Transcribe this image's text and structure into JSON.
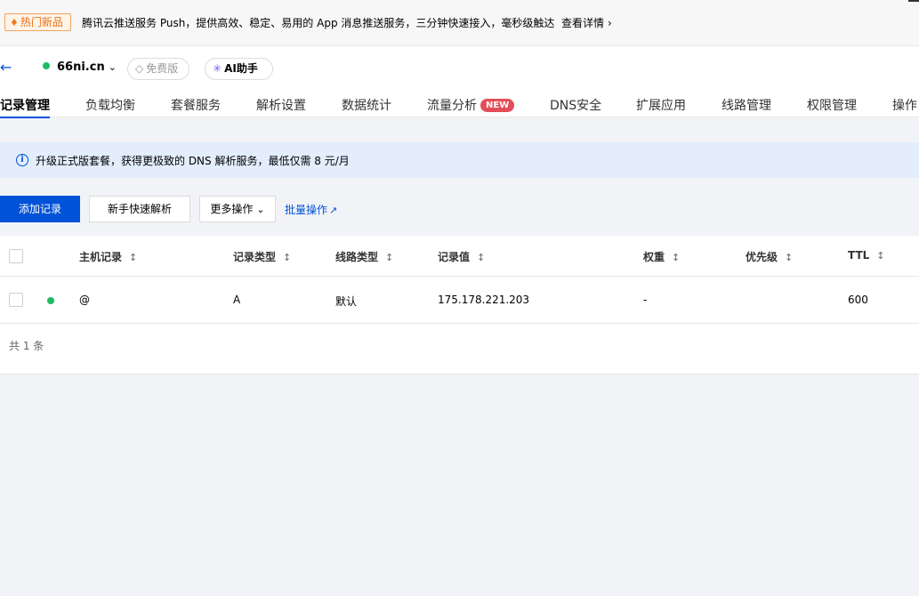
{
  "banner": {
    "badge": "热门新品",
    "text": "腾讯云推送服务 Push，提供高效、稳定、易用的 App 消息推送服务，三分钟快速接入，毫秒级触达",
    "link": "查看详情"
  },
  "header": {
    "domain": "66ni.cn",
    "free_plan": "免费版",
    "ai_assistant": "AI助手"
  },
  "tabs": [
    {
      "label": "记录管理",
      "active": true
    },
    {
      "label": "负载均衡"
    },
    {
      "label": "套餐服务"
    },
    {
      "label": "解析设置"
    },
    {
      "label": "数据统计"
    },
    {
      "label": "流量分析",
      "badge": "NEW"
    },
    {
      "label": "DNS安全"
    },
    {
      "label": "扩展应用"
    },
    {
      "label": "线路管理"
    },
    {
      "label": "权限管理"
    },
    {
      "label": "操作"
    }
  ],
  "info": {
    "text": "升级正式版套餐，获得更极致的 DNS 解析服务，最低仅需 8 元/月"
  },
  "toolbar": {
    "add_record": "添加记录",
    "quick_resolve": "新手快速解析",
    "more_actions": "更多操作",
    "batch_actions": "批量操作"
  },
  "table": {
    "columns": [
      "主机记录",
      "记录类型",
      "线路类型",
      "记录值",
      "权重",
      "优先级",
      "TTL"
    ],
    "rows": [
      {
        "host": "@",
        "type": "A",
        "line": "默认",
        "value": "175.178.221.203",
        "weight": "-",
        "priority": "",
        "ttl": "600"
      }
    ],
    "total": "共 1 条"
  },
  "colors": {
    "primary": "#0052d9",
    "status_green": "#1fbb64",
    "new_badge": "#e34d59",
    "info_bg": "#e3edfc"
  }
}
